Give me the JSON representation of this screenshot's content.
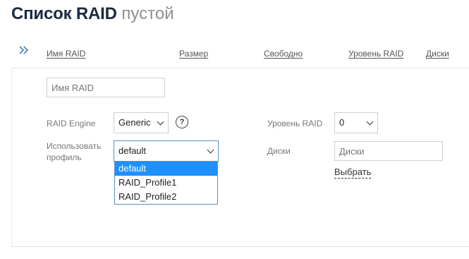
{
  "page": {
    "title_main": "Список RAID",
    "title_sub": "пустой"
  },
  "table": {
    "columns": [
      "Имя RAID",
      "Размер",
      "Свободно",
      "Уровень RAID",
      "Диски"
    ]
  },
  "form": {
    "name_placeholder": "Имя RAID",
    "engine_label": "RAID Engine",
    "engine_value": "Generic",
    "help_symbol": "?",
    "profile_label_1": "Использовать",
    "profile_label_2": "профиль",
    "profile_value": "default",
    "profile_options": [
      "default",
      "RAID_Profile1",
      "RAID_Profile2"
    ],
    "level_label": "Уровень RAID",
    "level_value": "0",
    "disks_label": "Диски",
    "disks_placeholder": "Диски",
    "select_link": "Выбрать"
  },
  "colors": {
    "accent": "#2a7ab8",
    "highlight": "#1e90ff"
  },
  "icons": {
    "expand": "double-chevron-right-icon",
    "help": "question-circle-icon",
    "dropdown": "chevron-down-icon"
  }
}
